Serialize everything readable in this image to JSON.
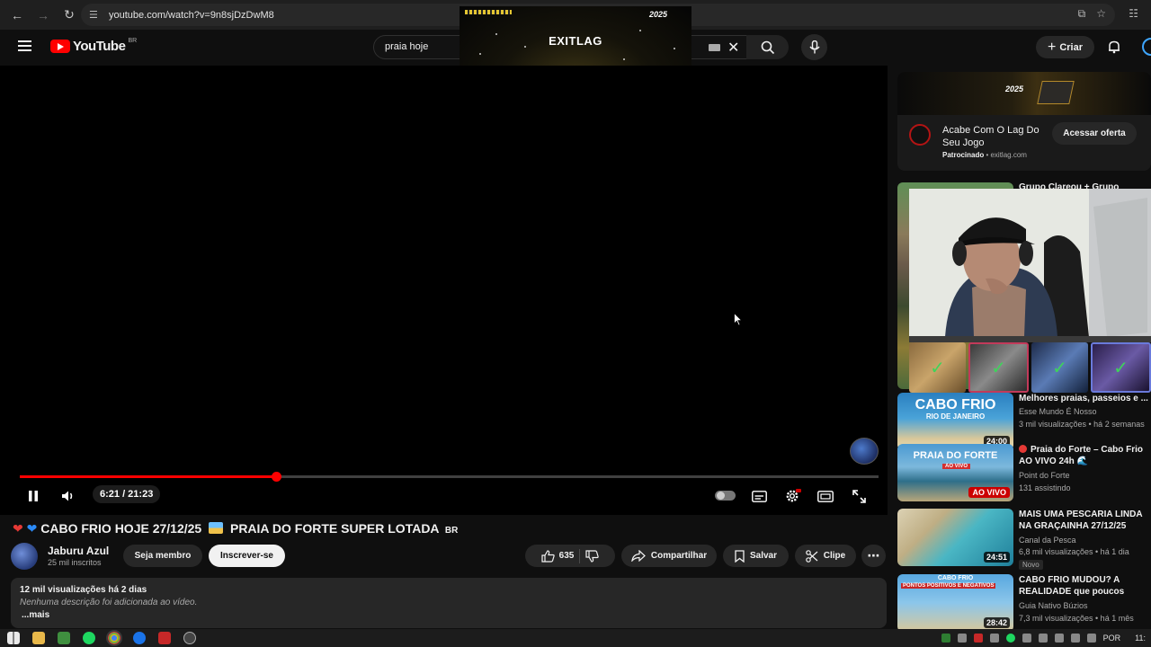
{
  "browser": {
    "url": "youtube.com/watch?v=9n8sjDzDwM8"
  },
  "header": {
    "logo_text": "YouTube",
    "region": "BR",
    "search_query": "praia hoje",
    "create_label": "Criar"
  },
  "overlay_ad": {
    "brand": "EXITLAG",
    "year": "2025",
    "dots": "..."
  },
  "player": {
    "progress_fraction": 0.298,
    "time_display": "6:21 / 21:23"
  },
  "video": {
    "title": "CABO FRIO HOJE 27/12/25",
    "title_rest": "PRAIA DO FORTE SUPER LOTADA",
    "title_suffix": "BR",
    "channel_name": "Jaburu Azul",
    "channel_subs": "25 mil inscritos",
    "join_label": "Seja membro",
    "subscribe_label": "Inscrever-se",
    "like_count": "635",
    "share_label": "Compartilhar",
    "save_label": "Salvar",
    "clip_label": "Clipe"
  },
  "description": {
    "views_date": "12 mil visualizações  há 2 dias",
    "text": "Nenhuma descrição foi adicionada ao vídeo.",
    "more": "...mais"
  },
  "sidebar_ad": {
    "banner_text": "2025",
    "title": "Acabe Com O Lag Do Seu Jogo",
    "sponsored": "Patrocinado",
    "domain": "exitlag.com",
    "cta": "Acessar oferta"
  },
  "partial_rec": {
    "title": "Grupo Clareou + Grupo"
  },
  "recommendations": [
    {
      "title": "Melhores praias, passeios e ...",
      "channel": "Esse Mundo É Nosso",
      "meta": "3 mil visualizações • há 2 semanas",
      "duration": "24:00",
      "thumb_text": "CABO FRIO",
      "thumb_sub": "RIO DE JANEIRO"
    },
    {
      "title": "Praia do Forte – Cabo Frio AO VIVO 24h 🌊",
      "channel": "Point do Forte",
      "meta": "131 assistindo",
      "live_label": "AO VIVO",
      "thumb_text": "PRAIA DO FORTE",
      "thumb_sub": "AO VIVO"
    },
    {
      "title": "MAIS UMA PESCARIA LINDA NA GRAÇAINHA 27/12/25",
      "channel": "Canal da Pesca",
      "meta": "6,8 mil visualizações • há 1 dia",
      "badge": "Novo",
      "duration": "24:51"
    },
    {
      "title": "CABO FRIO MUDOU? A REALIDADE que poucos contam",
      "channel": "Guia Nativo Búzios",
      "meta": "7,3 mil visualizações • há 1 mês",
      "duration": "28:42",
      "thumb_text": "CABO FRIO",
      "thumb_sub": "PONTOS POSITIVOS E NEGATIVOS"
    }
  ],
  "taskbar": {
    "lang": "POR",
    "clock": "11:"
  }
}
